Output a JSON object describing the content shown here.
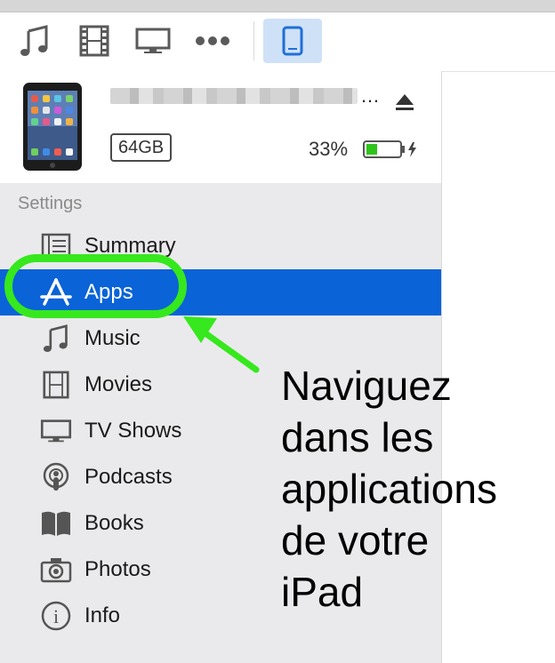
{
  "toolbar": {
    "buttons": [
      {
        "icon": "music-note-icon"
      },
      {
        "icon": "film-icon"
      },
      {
        "icon": "tv-icon"
      },
      {
        "icon": "more-icon"
      },
      {
        "icon": "ipad-device-icon",
        "active": true
      }
    ]
  },
  "device": {
    "capacity": "64GB",
    "ellipsis": "…",
    "battery_percent": "33%",
    "battery_level": 0.33
  },
  "sidebar": {
    "section_title": "Settings",
    "items": [
      {
        "label": "Summary",
        "icon": "summary-list-icon"
      },
      {
        "label": "Apps",
        "icon": "app-store-icon",
        "selected": true
      },
      {
        "label": "Music",
        "icon": "music-note-icon"
      },
      {
        "label": "Movies",
        "icon": "film-icon"
      },
      {
        "label": "TV Shows",
        "icon": "tv-icon"
      },
      {
        "label": "Podcasts",
        "icon": "podcast-icon"
      },
      {
        "label": "Books",
        "icon": "book-icon"
      },
      {
        "label": "Photos",
        "icon": "camera-icon"
      },
      {
        "label": "Info",
        "icon": "info-icon"
      }
    ]
  },
  "annotation": {
    "lines": [
      "Naviguez",
      "dans les",
      "applications",
      "de votre",
      "iPad"
    ]
  },
  "colors": {
    "selection": "#0a63d7",
    "highlight": "#36e81d",
    "battery": "#2fc41b"
  }
}
